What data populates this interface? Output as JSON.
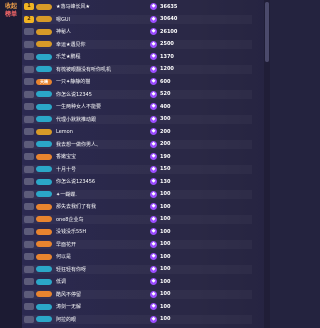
{
  "sidebar": {
    "tab_label": "收起",
    "tab_sub": "榜单"
  },
  "colors": {
    "background": "#24233f",
    "rank_gold": "#f0b323",
    "coin": "#9a4cff"
  },
  "rows": [
    {
      "rank": "1",
      "badge": "",
      "badge_color": "#d79a28",
      "name": "★落马峰长风★",
      "score": "36635"
    },
    {
      "rank": "2",
      "badge": "",
      "badge_color": "#d79a28",
      "name": "嗯GUI",
      "score": "30640"
    },
    {
      "rank": "",
      "badge": "",
      "badge_color": "#d79a28",
      "name": "神秘人",
      "score": "26100"
    },
    {
      "rank": "",
      "badge": "",
      "badge_color": "#d79a28",
      "name": "幸运★遇见你",
      "score": "2500"
    },
    {
      "rank": "",
      "badge": "",
      "badge_color": "#2ba7c8",
      "name": "乐芝★鹏程",
      "score": "1370"
    },
    {
      "rank": "",
      "badge": "",
      "badge_color": "#2ba7c8",
      "name": "有梳被眼翻没有听你叽机",
      "score": "1200"
    },
    {
      "rank": "",
      "badge": "天晴",
      "badge_color": "#e8842f",
      "name": "一只✦静静的猫",
      "score": "600"
    },
    {
      "rank": "",
      "badge": "",
      "badge_color": "#2ba7c8",
      "name": "你怎么说12345",
      "score": "520"
    },
    {
      "rank": "",
      "badge": "",
      "badge_color": "#2ba7c8",
      "name": "一生两种女人不能要",
      "score": "400"
    },
    {
      "rank": "",
      "badge": "",
      "badge_color": "#2ba7c8",
      "name": "代理小默默推动跟",
      "score": "300"
    },
    {
      "rank": "",
      "badge": "",
      "badge_color": "#d79a28",
      "name": "Lemon",
      "score": "200"
    },
    {
      "rank": "",
      "badge": "",
      "badge_color": "#2ba7c8",
      "name": "我去想一做你男人、",
      "score": "200"
    },
    {
      "rank": "",
      "badge": "",
      "badge_color": "#e8842f",
      "name": "香嫩宝宝",
      "score": "190"
    },
    {
      "rank": "",
      "badge": "",
      "badge_color": "#2ba7c8",
      "name": "十月十号",
      "score": "150"
    },
    {
      "rank": "",
      "badge": "",
      "badge_color": "#2ba7c8",
      "name": "你怎么说123456",
      "score": "130"
    },
    {
      "rank": "",
      "badge": "",
      "badge_color": "#2ba7c8",
      "name": "✦一蝴蝶.",
      "score": "100"
    },
    {
      "rank": "",
      "badge": "",
      "badge_color": "#e8842f",
      "name": "那失去我们了有我",
      "score": "100"
    },
    {
      "rank": "",
      "badge": "",
      "badge_color": "#e8842f",
      "name": "one8企业鸟",
      "score": "100"
    },
    {
      "rank": "",
      "badge": "",
      "badge_color": "#e8842f",
      "name": "没钱没乐55H",
      "score": "100"
    },
    {
      "rank": "",
      "badge": "",
      "badge_color": "#e8842f",
      "name": "早面花开",
      "score": "100"
    },
    {
      "rank": "",
      "badge": "",
      "badge_color": "#e8842f",
      "name": "何以是",
      "score": "100"
    },
    {
      "rank": "",
      "badge": "",
      "badge_color": "#2ba7c8",
      "name": "轻狂轻有你呀",
      "score": "100"
    },
    {
      "rank": "",
      "badge": "",
      "badge_color": "#2ba7c8",
      "name": "低调",
      "score": "100"
    },
    {
      "rank": "",
      "badge": "",
      "badge_color": "#e8842f",
      "name": "酷风不停留",
      "score": "100"
    },
    {
      "rank": "",
      "badge": "",
      "badge_color": "#2ba7c8",
      "name": "涛剑一无解",
      "score": "100"
    },
    {
      "rank": "",
      "badge": "",
      "badge_color": "#2ba7c8",
      "name": "阿拉的眼",
      "score": "100"
    }
  ]
}
